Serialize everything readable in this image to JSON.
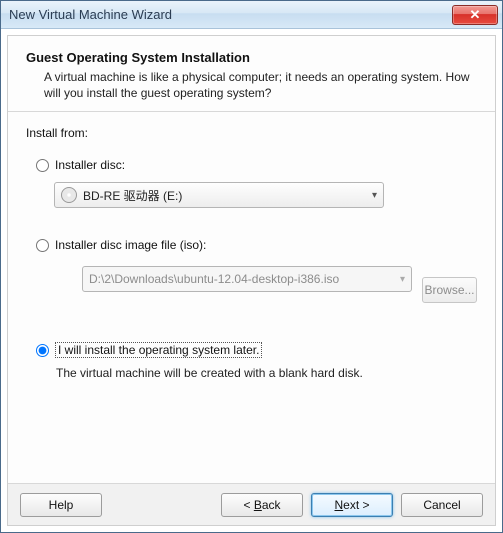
{
  "window": {
    "title": "New Virtual Machine Wizard"
  },
  "header": {
    "title": "Guest Operating System Installation",
    "desc": "A virtual machine is like a physical computer; it needs an operating system. How will you install the guest operating system?"
  },
  "install_from_label": "Install from:",
  "options": {
    "disc": {
      "label": "Installer disc:",
      "value": "BD-RE 驱动器 (E:)",
      "selected": false
    },
    "iso": {
      "label": "Installer disc image file (iso):",
      "value": "D:\\2\\Downloads\\ubuntu-12.04-desktop-i386.iso",
      "browse_label": "Browse...",
      "selected": false
    },
    "later": {
      "label": "I will install the operating system later.",
      "desc": "The virtual machine will be created with a blank hard disk.",
      "selected": true
    }
  },
  "footer": {
    "help": "Help",
    "back_prefix": "< ",
    "back_u": "B",
    "back_rest": "ack",
    "next_u": "N",
    "next_rest": "ext >",
    "cancel": "Cancel"
  }
}
